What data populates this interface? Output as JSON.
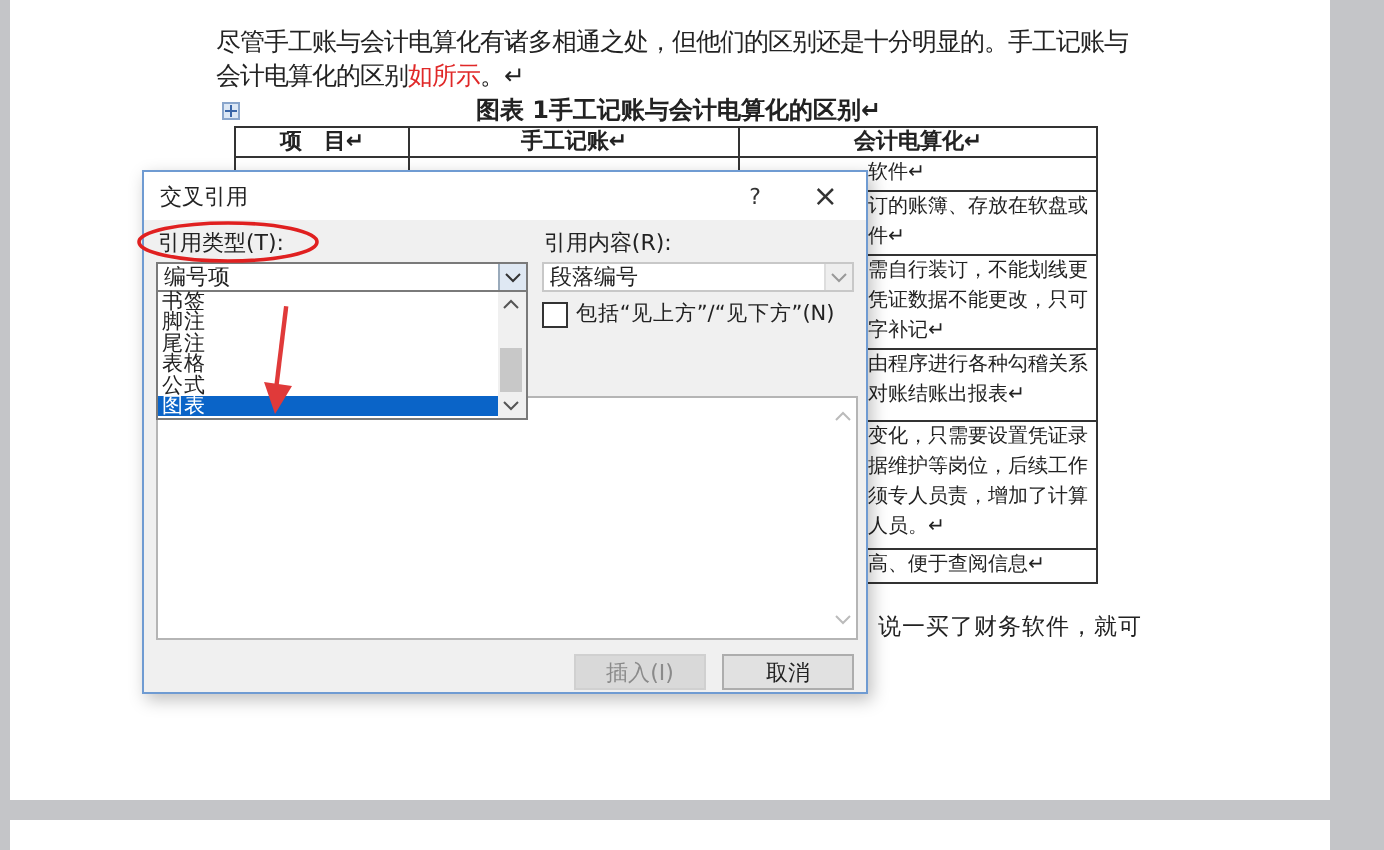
{
  "document": {
    "paragraph": {
      "runs": [
        {
          "text": "尽管手工账与会计电算化有诸多相通之处，但他们的区别还是十分明显的。手工记账与会计电算化的区别",
          "kind": "normal"
        },
        {
          "text": "如所示",
          "kind": "field"
        },
        {
          "text": "。↵",
          "kind": "normal"
        }
      ]
    },
    "caption": "图表 1手工记账与会计电算化的区别↵",
    "table": {
      "columns": [
        "项　目↵",
        "手工记账↵",
        "会计电算化↵"
      ],
      "rows": [
        {
          "column_3": [
            "软件↵"
          ]
        },
        {
          "column_3": [
            "订的账簿、存放在软盘或",
            "件↵"
          ]
        },
        {
          "column_3": [
            "需自行装订，不能划线更",
            "凭证数据不能更改，只可",
            "字补记↵"
          ]
        },
        {
          "column_3": [
            "由程序进行各种勾稽关系",
            "对账结账出报表↵"
          ]
        },
        {
          "column_3": [
            "变化，只需要设置凭证录",
            "据维护等岗位，后续工作",
            "须专人员责，增加了计算",
            "人员。↵"
          ]
        },
        {
          "column_3": [
            "高、便于查阅信息↵"
          ]
        }
      ]
    },
    "after_text": "说一买了财务软件，就可"
  },
  "dialog": {
    "title": "交叉引用",
    "help": "?",
    "close": "×",
    "reference_type": {
      "label": "引用类型(T):",
      "value": "编号项",
      "options": [
        {
          "label": "书签",
          "selected": false
        },
        {
          "label": "脚注",
          "selected": false
        },
        {
          "label": "尾注",
          "selected": false
        },
        {
          "label": "表格",
          "selected": false
        },
        {
          "label": "公式",
          "selected": false
        },
        {
          "label": "图表",
          "selected": true
        }
      ]
    },
    "reference_content": {
      "label": "引用内容(R):",
      "value": "段落编号"
    },
    "include_above_below": {
      "label": "包括“见上方”/“见下方”(N)",
      "checked": false
    },
    "buttons": [
      {
        "label": "插入(I)",
        "disabled": true
      },
      {
        "label": "取消",
        "disabled": false
      }
    ]
  }
}
